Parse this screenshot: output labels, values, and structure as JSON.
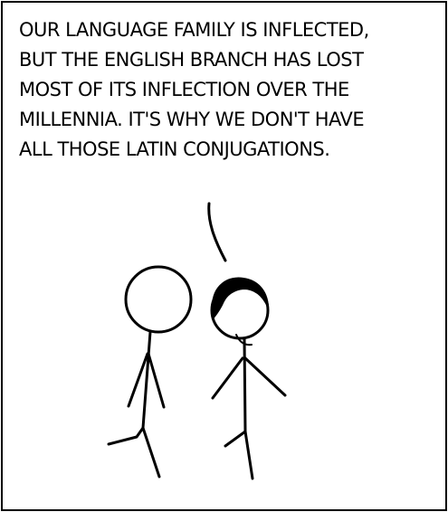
{
  "comic": {
    "caption_lines": [
      "OUR LANGUAGE FAMILY IS INFLECTED,",
      "BUT THE ENGLISH BRANCH HAS LOST",
      "MOST OF ITS INFLECTION OVER THE",
      "MILLENNIA. IT'S WHY WE DON'T HAVE",
      "ALL THOSE LATIN CONJUGATIONS."
    ]
  },
  "colors": {
    "ink": "#000000",
    "paper": "#ffffff"
  }
}
